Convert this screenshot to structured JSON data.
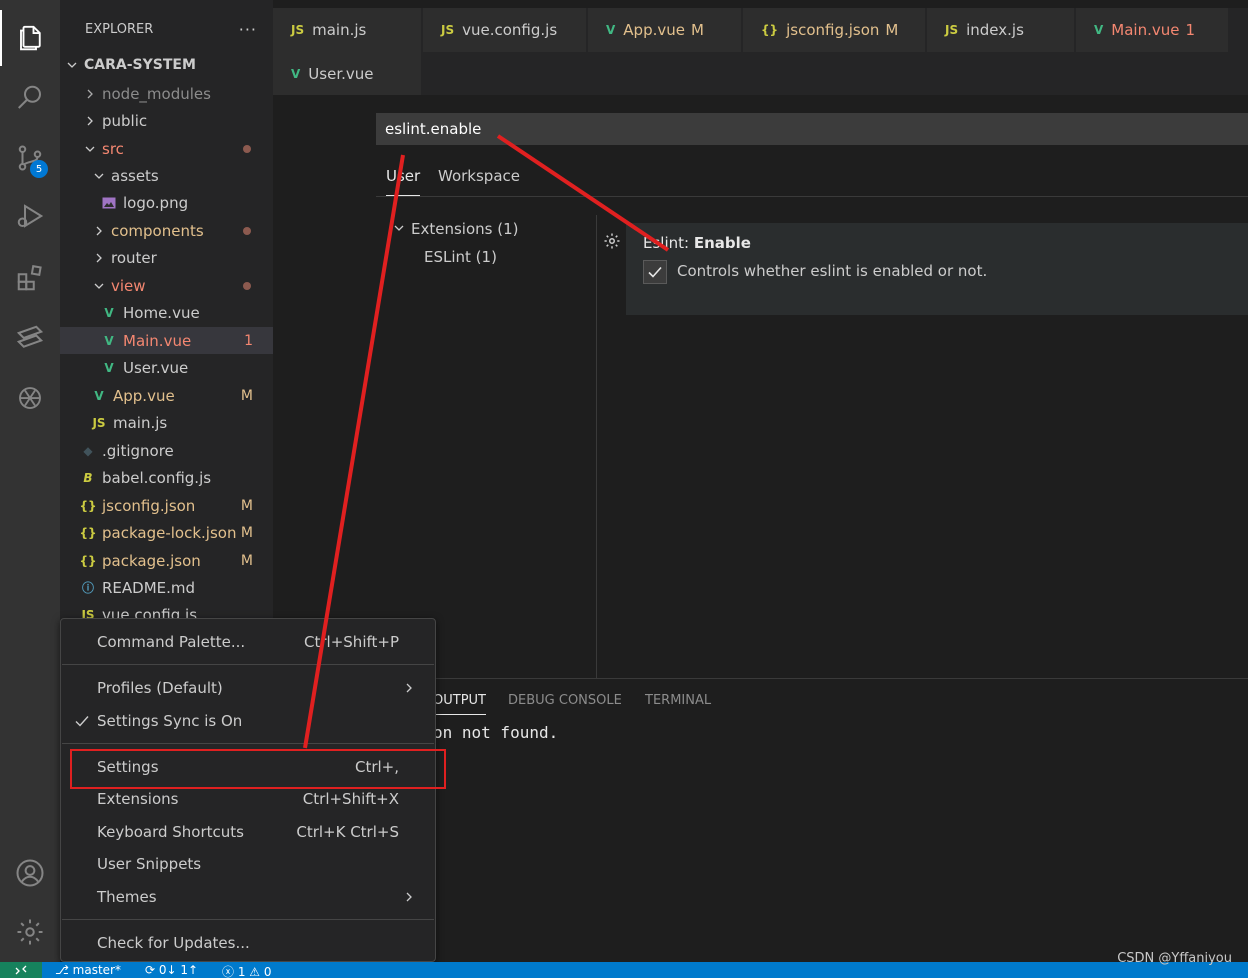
{
  "activity_bar": {
    "source_control_badge": "5",
    "icons": [
      "explorer-icon",
      "search-icon",
      "source-control-icon",
      "run-debug-icon",
      "extensions-icon",
      "remote-icon",
      "openai-icon",
      "account-icon",
      "manage-gear-icon"
    ]
  },
  "sidebar": {
    "title": "EXPLORER",
    "more": "···",
    "project": "CARA-SYSTEM",
    "items": [
      {
        "label": "node_modules",
        "deco": ""
      },
      {
        "label": "public",
        "deco": ""
      },
      {
        "label": "src",
        "deco": ""
      },
      {
        "label": "assets",
        "deco": ""
      },
      {
        "label": "logo.png",
        "deco": ""
      },
      {
        "label": "components",
        "deco": ""
      },
      {
        "label": "router",
        "deco": ""
      },
      {
        "label": "view",
        "deco": ""
      },
      {
        "label": "Home.vue",
        "deco": ""
      },
      {
        "label": "Main.vue",
        "deco": "1"
      },
      {
        "label": "User.vue",
        "deco": ""
      },
      {
        "label": "App.vue",
        "deco": "M"
      },
      {
        "label": "main.js",
        "deco": ""
      },
      {
        "label": ".gitignore",
        "deco": ""
      },
      {
        "label": "babel.config.js",
        "deco": ""
      },
      {
        "label": "jsconfig.json",
        "deco": "M"
      },
      {
        "label": "package-lock.json",
        "deco": "M"
      },
      {
        "label": "package.json",
        "deco": "M"
      },
      {
        "label": "README.md",
        "deco": ""
      },
      {
        "label": "vue.config.js",
        "deco": ""
      }
    ]
  },
  "tabs": [
    {
      "icon": "JS",
      "label": "main.js",
      "deco": ""
    },
    {
      "icon": "JS",
      "label": "vue.config.js",
      "deco": ""
    },
    {
      "icon": "V",
      "label": "App.vue",
      "deco": "M"
    },
    {
      "icon": "{}",
      "label": "jsconfig.json",
      "deco": "M"
    },
    {
      "icon": "JS",
      "label": "index.js",
      "deco": ""
    },
    {
      "icon": "V",
      "label": "Main.vue",
      "deco": "1"
    },
    {
      "icon": "V",
      "label": "User.vue",
      "deco": ""
    }
  ],
  "settings": {
    "search_value": "eslint.enable",
    "scope_tabs": [
      "User",
      "Workspace"
    ],
    "toc": [
      {
        "label": "Extensions (1)"
      },
      {
        "label": "ESLint (1)"
      }
    ],
    "setting_category": "Eslint: ",
    "setting_name": "Enable",
    "setting_description": "Controls whether eslint is enabled or not.",
    "checked": true
  },
  "panel": {
    "tabs": [
      "OUTPUT",
      "DEBUG CONSOLE",
      "TERMINAL"
    ],
    "output_text": "on not found."
  },
  "menu": {
    "items": [
      {
        "label": "Command Palette...",
        "shortcut": "Ctrl+Shift+P"
      },
      {
        "label": "Profiles (Default)",
        "shortcut": ""
      },
      {
        "label": "Settings Sync is On",
        "shortcut": ""
      },
      {
        "label": "Settings",
        "shortcut": "Ctrl+,"
      },
      {
        "label": "Extensions",
        "shortcut": "Ctrl+Shift+X"
      },
      {
        "label": "Keyboard Shortcuts",
        "shortcut": "Ctrl+K Ctrl+S"
      },
      {
        "label": "User Snippets",
        "shortcut": ""
      },
      {
        "label": "Themes",
        "shortcut": ""
      },
      {
        "label": "Check for Updates...",
        "shortcut": ""
      }
    ]
  },
  "statusbar": {
    "branch": "master*",
    "sync": "0↓ 1↑",
    "errors": "1",
    "warnings": "0"
  },
  "watermark": "CSDN @Yffaniyou",
  "colors": {
    "accent": "#007acc",
    "annotation_red": "#e02020",
    "vue_green": "#41b883",
    "js_yellow": "#cbcb41"
  }
}
